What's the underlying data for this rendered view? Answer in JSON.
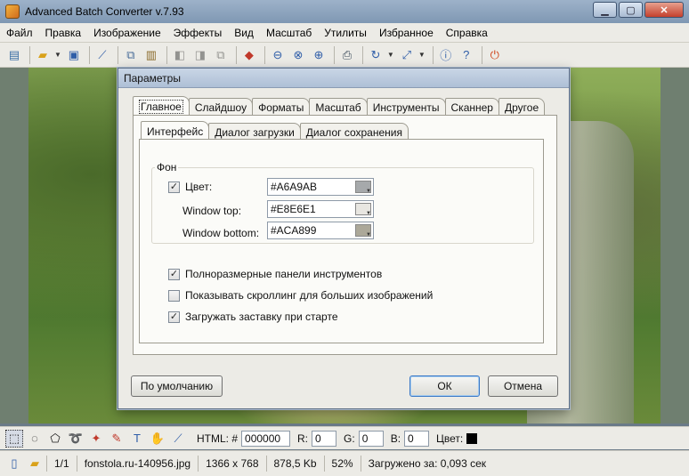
{
  "window": {
    "title": "Advanced Batch Converter v.7.93"
  },
  "menu": [
    "Файл",
    "Правка",
    "Изображение",
    "Эффекты",
    "Вид",
    "Масштаб",
    "Утилиты",
    "Избранное",
    "Справка"
  ],
  "dialog": {
    "title": "Параметры",
    "tabs": [
      "Главное",
      "Слайдшоу",
      "Форматы",
      "Масштаб",
      "Инструменты",
      "Сканнер",
      "Другое"
    ],
    "subtabs": [
      "Интерфейс",
      "Диалог загрузки",
      "Диалог сохранения"
    ],
    "group_label": "Фон",
    "color_label": "Цвет:",
    "color_checked": true,
    "color_value": "#A6A9AB",
    "window_top_label": "Window top:",
    "window_top_value": "#E8E6E1",
    "window_bottom_label": "Window bottom:",
    "window_bottom_value": "#ACA899",
    "swatch_colors": {
      "color": "#A6A9AB",
      "window_top": "#E8E6E1",
      "window_bottom": "#ACA899"
    },
    "options": [
      {
        "label": "Полноразмерные панели инструментов",
        "checked": true
      },
      {
        "label": "Показывать скроллинг для больших изображений",
        "checked": false
      },
      {
        "label": "Загружать заставку при старте",
        "checked": true
      }
    ],
    "default_button": "По умолчанию",
    "ok_button": "ОК",
    "cancel_button": "Отмена"
  },
  "tools": {
    "html_label": "HTML: #",
    "html_value": "000000",
    "r_label": "R:",
    "r_value": "0",
    "g_label": "G:",
    "g_value": "0",
    "b_label": "B:",
    "b_value": "0",
    "color_label": "Цвет:"
  },
  "status": {
    "index": "1/1",
    "filename": "fonstola.ru-140956.jpg",
    "dimensions": "1366 x 768",
    "filesize": "878,5 Kb",
    "zoom": "52%",
    "loaded": "Загружено за: 0,093 сек"
  }
}
